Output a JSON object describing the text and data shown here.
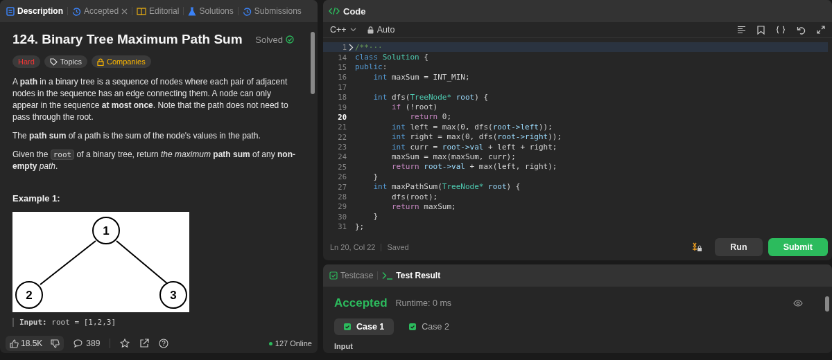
{
  "description_panel": {
    "tabs": [
      {
        "kind": "description",
        "label": "Description",
        "selected": true,
        "closable": false
      },
      {
        "kind": "accepted",
        "label": "Accepted",
        "selected": false,
        "closable": true
      },
      {
        "kind": "editorial",
        "label": "Editorial",
        "selected": false,
        "closable": false
      },
      {
        "kind": "solutions",
        "label": "Solutions",
        "selected": false,
        "closable": false
      },
      {
        "kind": "submissions",
        "label": "Submissions",
        "selected": false,
        "closable": false
      }
    ],
    "title": "124. Binary Tree Maximum Path Sum",
    "status": "Solved",
    "tags": [
      {
        "kind": "difficulty",
        "label": "Hard"
      },
      {
        "kind": "topics",
        "label": "Topics"
      },
      {
        "kind": "companies",
        "label": "Companies"
      }
    ],
    "paragraphs": [
      [
        {
          "kind": "text",
          "text": "A **path** in a binary tree is a sequence of nodes where each pair of adjacent nodes in the sequence has an edge connecting them. A node can only appear in the sequence **at most once**. Note that the path does not need to pass through the root."
        }
      ],
      [
        {
          "kind": "text",
          "text": "The **path sum** of a path is the sum of the node's values in the path."
        }
      ],
      [
        {
          "kind": "text",
          "text": "Given the "
        },
        {
          "kind": "code",
          "text": "root"
        },
        {
          "kind": "text",
          "text": " of a binary tree, return *the maximum* **path sum** of any **non-empty** *path*."
        }
      ]
    ],
    "example_heading": "Example 1:",
    "tree_nodes": [
      "1",
      "2",
      "3"
    ],
    "example_input": {
      "label": "Input:",
      "text": "root = [1,2,3]"
    },
    "footer": {
      "likes": "18.5K",
      "comments": "389",
      "online": "127 Online"
    }
  },
  "code_panel": {
    "title": "Code",
    "language": "C++",
    "mode": "Auto",
    "lines": [
      {
        "num": "1",
        "folded": true,
        "highlighted": true,
        "current": false,
        "tokens": [
          {
            "kind": "comment",
            "text": "/**···"
          }
        ]
      },
      {
        "num": "14",
        "folded": false,
        "highlighted": false,
        "current": false,
        "tokens": [
          {
            "kind": "kw",
            "text": "class"
          },
          {
            "kind": "type",
            "text": " Solution"
          },
          {
            "kind": "plain",
            "text": " {"
          }
        ]
      },
      {
        "num": "15",
        "folded": false,
        "highlighted": false,
        "current": false,
        "tokens": [
          {
            "kind": "kw",
            "text": "public"
          },
          {
            "kind": "plain",
            "text": ":"
          }
        ]
      },
      {
        "num": "16",
        "folded": false,
        "highlighted": false,
        "current": false,
        "tokens": [
          {
            "kind": "kw",
            "text": "    int"
          },
          {
            "kind": "plain",
            "text": " maxSum = INT_MIN;"
          }
        ]
      },
      {
        "num": "17",
        "folded": false,
        "highlighted": false,
        "current": false
      },
      {
        "num": "18",
        "folded": false,
        "highlighted": false,
        "current": false,
        "tokens": [
          {
            "kind": "kw",
            "text": "    int"
          },
          {
            "kind": "plain",
            "text": " dfs("
          },
          {
            "kind": "type",
            "text": "TreeNode*"
          },
          {
            "kind": "var",
            "text": " root"
          },
          {
            "kind": "plain",
            "text": ") {"
          }
        ]
      },
      {
        "num": "19",
        "folded": false,
        "highlighted": false,
        "current": false,
        "tokens": [
          {
            "kind": "ctrl",
            "text": "        if"
          },
          {
            "kind": "plain",
            "text": " (!root)"
          }
        ]
      },
      {
        "num": "20",
        "folded": false,
        "highlighted": false,
        "current": true,
        "tokens": [
          {
            "kind": "ctrl",
            "text": "            return"
          },
          {
            "kind": "plain",
            "text": " 0;"
          }
        ]
      },
      {
        "num": "21",
        "folded": false,
        "highlighted": false,
        "current": false,
        "tokens": [
          {
            "kind": "kw",
            "text": "        int"
          },
          {
            "kind": "plain",
            "text": " left = max(0, dfs("
          },
          {
            "kind": "var",
            "text": "root->left"
          },
          {
            "kind": "plain",
            "text": "));"
          }
        ]
      },
      {
        "num": "22",
        "folded": false,
        "highlighted": false,
        "current": false,
        "tokens": [
          {
            "kind": "kw",
            "text": "        int"
          },
          {
            "kind": "plain",
            "text": " right = max(0, dfs("
          },
          {
            "kind": "var",
            "text": "root->right"
          },
          {
            "kind": "plain",
            "text": "));"
          }
        ]
      },
      {
        "num": "23",
        "folded": false,
        "highlighted": false,
        "current": false,
        "tokens": [
          {
            "kind": "kw",
            "text": "        int"
          },
          {
            "kind": "plain",
            "text": " curr = "
          },
          {
            "kind": "var",
            "text": "root->val"
          },
          {
            "kind": "plain",
            "text": " + left + right;"
          }
        ]
      },
      {
        "num": "24",
        "folded": false,
        "highlighted": false,
        "current": false,
        "tokens": [
          {
            "kind": "plain",
            "text": "        maxSum = max(maxSum, curr);"
          }
        ]
      },
      {
        "num": "25",
        "folded": false,
        "highlighted": false,
        "current": false,
        "tokens": [
          {
            "kind": "ctrl",
            "text": "        return"
          },
          {
            "kind": "var",
            "text": " root->val"
          },
          {
            "kind": "plain",
            "text": " + max(left, right);"
          }
        ]
      },
      {
        "num": "26",
        "folded": false,
        "highlighted": false,
        "current": false,
        "tokens": [
          {
            "kind": "plain",
            "text": "    }"
          }
        ]
      },
      {
        "num": "27",
        "folded": false,
        "highlighted": false,
        "current": false,
        "tokens": [
          {
            "kind": "kw",
            "text": "    int"
          },
          {
            "kind": "plain",
            "text": " maxPathSum("
          },
          {
            "kind": "type",
            "text": "TreeNode*"
          },
          {
            "kind": "var",
            "text": " root"
          },
          {
            "kind": "plain",
            "text": ") {"
          }
        ]
      },
      {
        "num": "28",
        "folded": false,
        "highlighted": false,
        "current": false,
        "tokens": [
          {
            "kind": "plain",
            "text": "        dfs(root);"
          }
        ]
      },
      {
        "num": "29",
        "folded": false,
        "highlighted": false,
        "current": false,
        "tokens": [
          {
            "kind": "ctrl",
            "text": "        return"
          },
          {
            "kind": "plain",
            "text": " maxSum;"
          }
        ]
      },
      {
        "num": "30",
        "folded": false,
        "highlighted": false,
        "current": false,
        "tokens": [
          {
            "kind": "plain",
            "text": "    }"
          }
        ]
      },
      {
        "num": "31",
        "folded": false,
        "highlighted": false,
        "current": false,
        "tokens": [
          {
            "kind": "plain",
            "text": "};"
          }
        ]
      }
    ],
    "cursor": "Ln 20, Col 22",
    "save_state": "Saved",
    "buttons": [
      {
        "kind": "run",
        "label": "Run"
      },
      {
        "kind": "submit",
        "label": "Submit"
      }
    ]
  },
  "result_panel": {
    "tabs": [
      {
        "kind": "testcase",
        "label": "Testcase",
        "selected": false
      },
      {
        "kind": "result",
        "label": "Test Result",
        "selected": true
      }
    ],
    "verdict": "Accepted",
    "runtime": "Runtime: 0 ms",
    "cases": [
      {
        "label": "Case 1",
        "selected": true,
        "passed": true
      },
      {
        "label": "Case 2",
        "selected": false,
        "passed": true
      }
    ],
    "section_label": "Input"
  }
}
